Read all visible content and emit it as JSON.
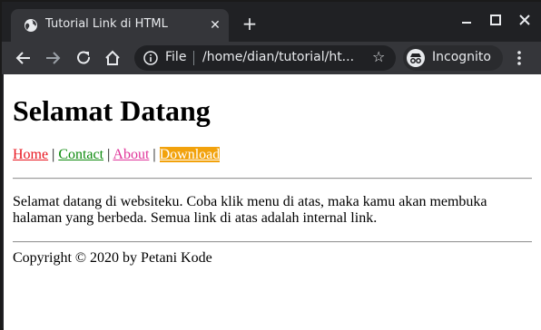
{
  "browser": {
    "tab": {
      "title": "Tutorial Link di HTML",
      "close_glyph": "✕",
      "favicon": "globe-icon"
    },
    "new_tab_glyph": "+",
    "window_controls": [
      "minimize-icon",
      "maximize-icon",
      "close-icon"
    ],
    "toolbar": {
      "back": "back-arrow-icon",
      "forward": "forward-arrow-icon",
      "reload": "reload-icon",
      "home": "home-icon"
    },
    "omnibox": {
      "scheme_label": "File",
      "url": "/home/dian/tutorial/ht...",
      "star_glyph": "☆"
    },
    "incognito_label": "Incognito"
  },
  "page": {
    "heading": "Selamat Datang",
    "nav": {
      "links": [
        {
          "label": "Home",
          "color": "#e8141e"
        },
        {
          "label": "Contact",
          "color": "#0c8a0c"
        },
        {
          "label": "About",
          "color": "#e0359a"
        },
        {
          "label": "Download",
          "color": "#ffffff",
          "background": "#f2a20c"
        }
      ],
      "separator": "|"
    },
    "paragraph": "Selamat datang di websiteku. Coba klik menu di atas, maka kamu akan membuka halaman yang berbeda. Semua link di atas adalah internal link.",
    "footer": "Copyright © 2020 by Petani Kode"
  }
}
